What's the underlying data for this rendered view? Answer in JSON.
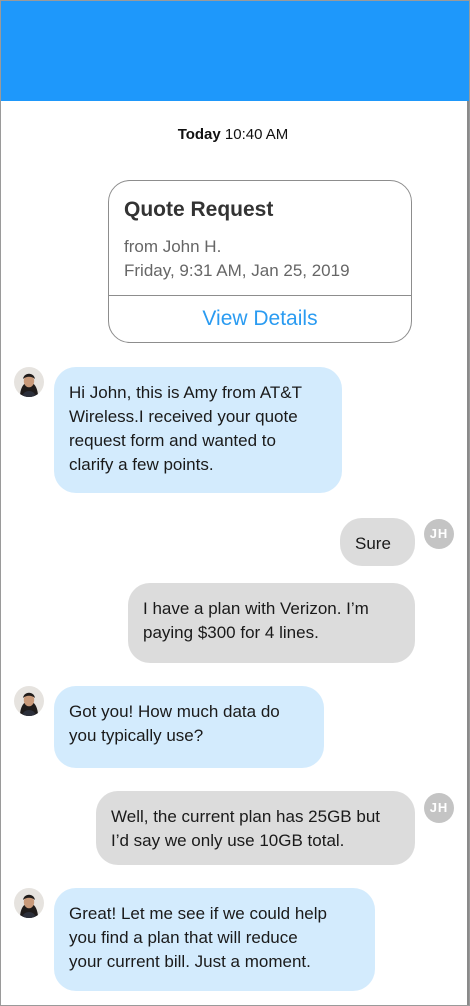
{
  "header": {
    "color": "#1e98fb"
  },
  "timestamp": {
    "day": "Today",
    "time": "10:40 AM"
  },
  "card": {
    "title": "Quote Request",
    "from": "from John H.",
    "date": "Friday, 9:31 AM, Jan 25, 2019",
    "action": "View Details"
  },
  "avatars": {
    "customer_initials": "JH",
    "agent_icon": "agent-photo-avatar"
  },
  "messages": [
    {
      "sender": "agent",
      "lines": [
        "Hi John, this is Amy from AT&T",
        "Wireless.I received your quote",
        "request form and wanted to",
        "clarify a few points."
      ]
    },
    {
      "sender": "customer",
      "lines": [
        "Sure"
      ]
    },
    {
      "sender": "customer",
      "lines": [
        "I have a plan with Verizon. I’m",
        "paying $300 for 4 lines."
      ]
    },
    {
      "sender": "agent",
      "lines": [
        "Got you! How much data do",
        "you typically use?"
      ]
    },
    {
      "sender": "customer",
      "lines": [
        "Well, the current plan has 25GB but",
        "I’d say we only use 10GB total."
      ]
    },
    {
      "sender": "agent",
      "lines": [
        "Great! Let me see if we could help",
        "you find a plan that will reduce",
        "your current bill. Just a moment."
      ]
    }
  ]
}
